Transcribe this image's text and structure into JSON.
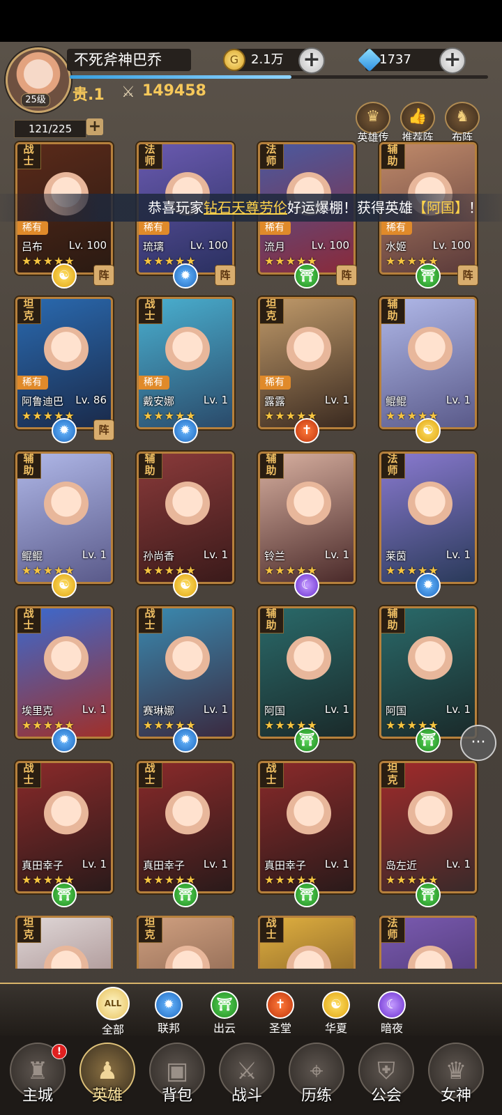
{
  "player": {
    "name": "不死斧神巴乔",
    "level": "25级",
    "noble": "贵.1",
    "power": "149458",
    "gold": "2.1万",
    "gems": "1737",
    "hero_count": "121/225",
    "exp_progress": 0.53
  },
  "top_buttons": [
    {
      "label": "英雄传",
      "icon": "crown-icon"
    },
    {
      "label": "推荐阵",
      "icon": "thumbs-up-icon"
    },
    {
      "label": "布阵",
      "icon": "knight-icon"
    }
  ],
  "ticker": {
    "prefix": "恭喜玩家",
    "player": "钻石天尊劳伦",
    "middle": "好运爆棚！获得英雄",
    "hero": "【阿国】",
    "suffix": "！"
  },
  "heroes": [
    {
      "class": "战\n士",
      "name": "吕布",
      "level": "Lv. 100",
      "stars": "★★★★★",
      "rare": "稀有",
      "faction": "huaxia",
      "formation": "阵",
      "colors": [
        "#5a2a1a",
        "#2a1a12"
      ]
    },
    {
      "class": "法\n师",
      "name": "琉璃",
      "level": "Lv. 100",
      "stars": "★★★★★",
      "rare": "稀有",
      "faction": "lianbang",
      "formation": "阵",
      "colors": [
        "#6a5ab0",
        "#2a3060"
      ]
    },
    {
      "class": "法\n师",
      "name": "流月",
      "level": "Lv. 100",
      "stars": "★★★★★",
      "rare": "稀有",
      "faction": "chuyun",
      "formation": "阵",
      "colors": [
        "#4a5aa0",
        "#8a2a3a"
      ]
    },
    {
      "class": "辅\n助",
      "name": "水姬",
      "level": "Lv. 100",
      "stars": "★★★★★",
      "rare": "稀有",
      "faction": "chuyun",
      "formation": "阵",
      "colors": [
        "#c08a6a",
        "#5a3a3a"
      ]
    },
    {
      "class": "坦\n克",
      "name": "阿鲁迪巴",
      "level": "Lv. 86",
      "stars": "★★★★★",
      "rare": "稀有",
      "faction": "lianbang",
      "formation": "阵",
      "colors": [
        "#2a6ab0",
        "#1a2a4a"
      ]
    },
    {
      "class": "战\n士",
      "name": "戴安娜",
      "level": "Lv. 1",
      "stars": "★★★★★",
      "rare": "稀有",
      "faction": "lianbang",
      "formation": "",
      "colors": [
        "#4ab0d0",
        "#2a4a6a"
      ]
    },
    {
      "class": "坦\n克",
      "name": "露露",
      "level": "Lv. 1",
      "stars": "★★★★★",
      "rare": "稀有",
      "faction": "shengtang",
      "formation": "",
      "colors": [
        "#c09a6a",
        "#3a2a20"
      ]
    },
    {
      "class": "辅\n助",
      "name": "鲲鲲",
      "level": "Lv. 1",
      "stars": "★★★★★",
      "rare": "",
      "faction": "huaxia",
      "formation": "",
      "colors": [
        "#b0b8e8",
        "#5a5a8a"
      ]
    },
    {
      "class": "辅\n助",
      "name": "鲲鲲",
      "level": "Lv. 1",
      "stars": "★★★★★",
      "rare": "",
      "faction": "huaxia",
      "formation": "",
      "colors": [
        "#b0b8e8",
        "#5a5a8a"
      ]
    },
    {
      "class": "辅\n助",
      "name": "孙尚香",
      "level": "Lv. 1",
      "stars": "★★★★★",
      "rare": "",
      "faction": "huaxia",
      "formation": "",
      "colors": [
        "#8a3a3a",
        "#3a1a1a"
      ]
    },
    {
      "class": "辅\n助",
      "name": "铃兰",
      "level": "Lv. 1",
      "stars": "★★★★★",
      "rare": "",
      "faction": "anye",
      "formation": "",
      "colors": [
        "#d8b0a0",
        "#4a2a2a"
      ]
    },
    {
      "class": "法\n师",
      "name": "莱茵",
      "level": "Lv. 1",
      "stars": "★★★★★",
      "rare": "",
      "faction": "lianbang",
      "formation": "",
      "colors": [
        "#8a7ad0",
        "#2a3a5a"
      ]
    },
    {
      "class": "战\n士",
      "name": "埃里克",
      "level": "Lv. 1",
      "stars": "★★★★★",
      "rare": "",
      "faction": "lianbang",
      "formation": "",
      "colors": [
        "#3a6ad0",
        "#a0302a"
      ]
    },
    {
      "class": "战\n士",
      "name": "赛琳娜",
      "level": "Lv. 1",
      "stars": "★★★★★",
      "rare": "",
      "faction": "lianbang",
      "formation": "",
      "colors": [
        "#3a8ab0",
        "#3a2a40"
      ]
    },
    {
      "class": "辅\n助",
      "name": "阿国",
      "level": "Lv. 1",
      "stars": "★★★★★",
      "rare": "",
      "faction": "chuyun",
      "formation": "",
      "colors": [
        "#2a6a6a",
        "#1a2a2a"
      ]
    },
    {
      "class": "辅\n助",
      "name": "阿国",
      "level": "Lv. 1",
      "stars": "★★★★★",
      "rare": "",
      "faction": "chuyun",
      "formation": "",
      "colors": [
        "#2a6a6a",
        "#1a2a2a"
      ]
    },
    {
      "class": "战\n士",
      "name": "真田幸子",
      "level": "Lv. 1",
      "stars": "★★★★★",
      "rare": "",
      "faction": "chuyun",
      "formation": "",
      "colors": [
        "#8a2a2a",
        "#2a1a1a"
      ]
    },
    {
      "class": "战\n士",
      "name": "真田幸子",
      "level": "Lv. 1",
      "stars": "★★★★★",
      "rare": "",
      "faction": "chuyun",
      "formation": "",
      "colors": [
        "#8a2a2a",
        "#2a1a1a"
      ]
    },
    {
      "class": "战\n士",
      "name": "真田幸子",
      "level": "Lv. 1",
      "stars": "★★★★★",
      "rare": "",
      "faction": "chuyun",
      "formation": "",
      "colors": [
        "#8a2a2a",
        "#2a1a1a"
      ]
    },
    {
      "class": "坦\n克",
      "name": "岛左近",
      "level": "Lv. 1",
      "stars": "★★★★★",
      "rare": "",
      "faction": "chuyun",
      "formation": "",
      "colors": [
        "#a02a2a",
        "#3a2a2a"
      ]
    },
    {
      "class": "坦\n克",
      "name": "",
      "level": "",
      "stars": "",
      "rare": "",
      "faction": "",
      "formation": "",
      "colors": [
        "#e0d8d8",
        "#8a6a6a"
      ]
    },
    {
      "class": "坦\n克",
      "name": "",
      "level": "",
      "stars": "",
      "rare": "",
      "faction": "",
      "formation": "",
      "colors": [
        "#d0a080",
        "#6a4a3a"
      ]
    },
    {
      "class": "战\n士",
      "name": "",
      "level": "",
      "stars": "",
      "rare": "",
      "faction": "",
      "formation": "",
      "colors": [
        "#e0b040",
        "#5a3a1a"
      ]
    },
    {
      "class": "法\n师",
      "name": "",
      "level": "",
      "stars": "",
      "rare": "",
      "faction": "",
      "formation": "",
      "colors": [
        "#7a5ab0",
        "#3a2a5a"
      ]
    }
  ],
  "faction_icons": {
    "huaxia": {
      "glyph": "☯",
      "cls": "f-hx"
    },
    "lianbang": {
      "glyph": "✹",
      "cls": "f-lb"
    },
    "chuyun": {
      "glyph": "⛩",
      "cls": "f-cy"
    },
    "shengtang": {
      "glyph": "✝",
      "cls": "f-st"
    },
    "anye": {
      "glyph": "☾",
      "cls": "f-ay"
    }
  },
  "filters": [
    {
      "label": "全部",
      "glyph": "ALL",
      "cls": "f-all",
      "name": "filter-all"
    },
    {
      "label": "联邦",
      "glyph": "✹",
      "cls": "f-lb",
      "name": "filter-lianbang"
    },
    {
      "label": "出云",
      "glyph": "⛩",
      "cls": "f-cy",
      "name": "filter-chuyun"
    },
    {
      "label": "圣堂",
      "glyph": "✝",
      "cls": "f-st",
      "name": "filter-shengtang"
    },
    {
      "label": "华夏",
      "glyph": "☯",
      "cls": "f-hx",
      "name": "filter-huaxia"
    },
    {
      "label": "暗夜",
      "glyph": "☾",
      "cls": "f-ay",
      "name": "filter-anye"
    }
  ],
  "nav": [
    {
      "label": "主城",
      "icon": "castle-icon",
      "glyph": "♜",
      "badge": "!"
    },
    {
      "label": "英雄",
      "icon": "hero-icon",
      "glyph": "♟",
      "active": true
    },
    {
      "label": "背包",
      "icon": "backpack-icon",
      "glyph": "▣"
    },
    {
      "label": "战斗",
      "icon": "crossed-swords-icon",
      "glyph": "⚔"
    },
    {
      "label": "历练",
      "icon": "map-icon",
      "glyph": "⌖"
    },
    {
      "label": "公会",
      "icon": "shield-icon",
      "glyph": "⛨"
    },
    {
      "label": "女神",
      "icon": "goddess-icon",
      "glyph": "♛"
    }
  ],
  "chat_label": "···"
}
